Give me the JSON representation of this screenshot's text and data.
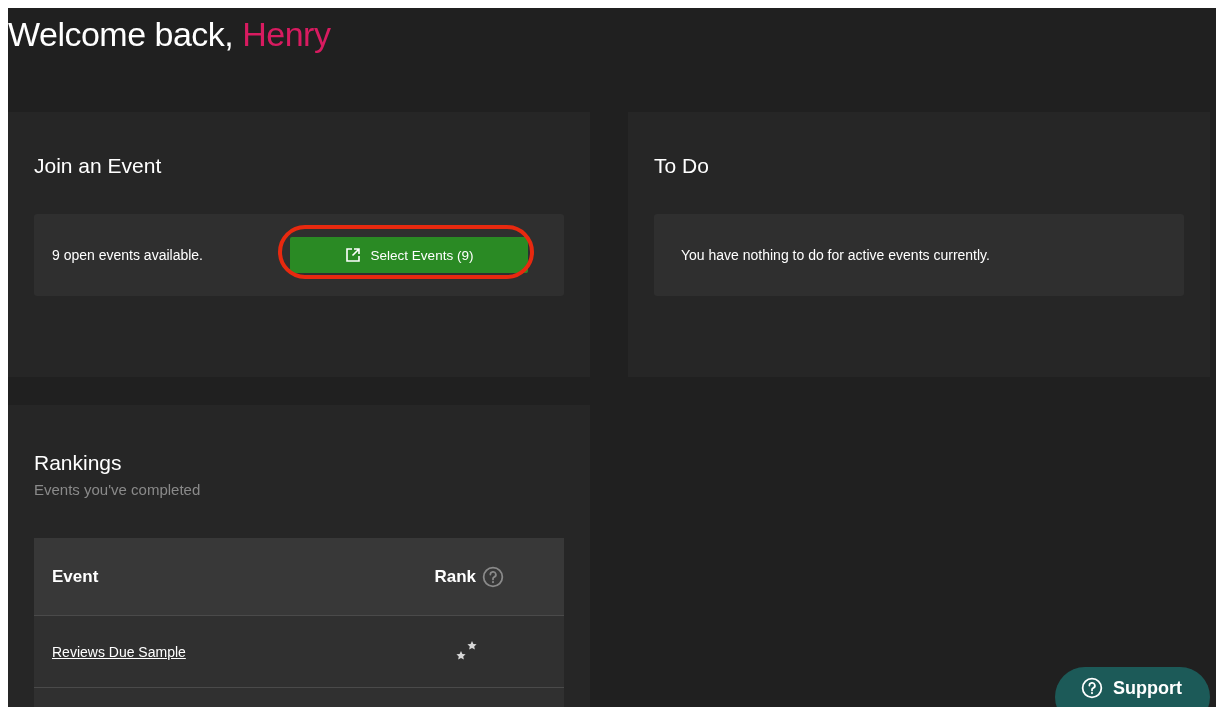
{
  "greeting": {
    "text": "Welcome back,",
    "name": "Henry"
  },
  "join": {
    "title": "Join an Event",
    "message": "9 open events available.",
    "button": "Select Events (9)",
    "highlighted": true
  },
  "todo": {
    "title": "To Do",
    "message": "You have nothing to do for active events currently."
  },
  "rankings": {
    "title": "Rankings",
    "subtitle": "Events you've completed",
    "columns": [
      "Event",
      "Rank"
    ],
    "rows": [
      {
        "event": "Reviews Due Sample"
      }
    ]
  },
  "support": {
    "label": "Support"
  }
}
